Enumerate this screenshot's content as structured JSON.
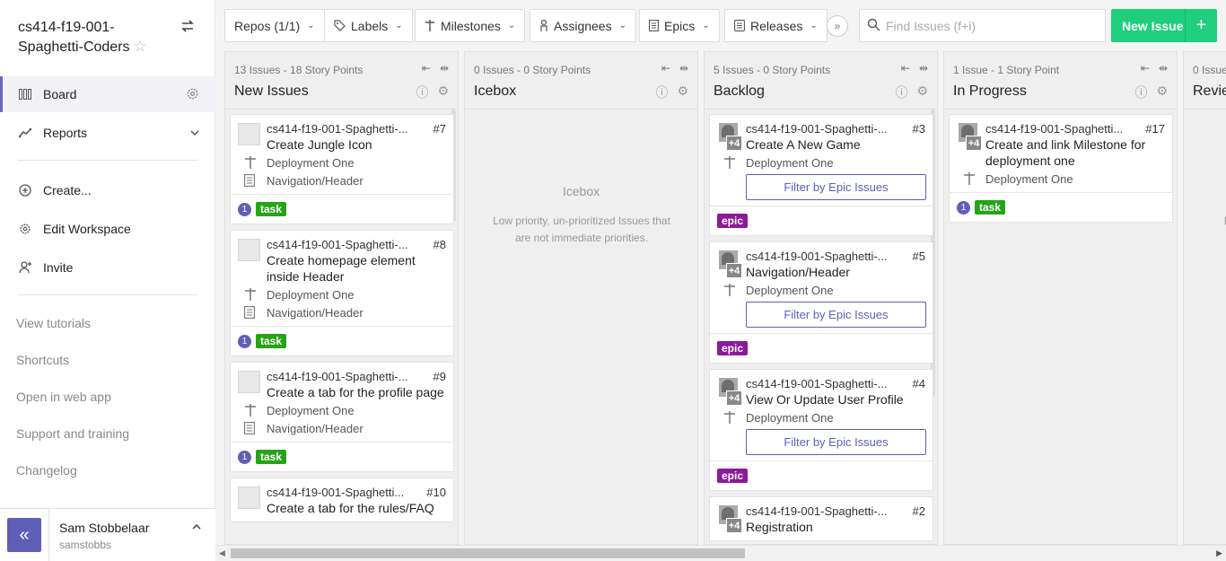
{
  "workspace": {
    "title": "cs414-f19-001-Spaghetti-Coders"
  },
  "nav": {
    "board": "Board",
    "reports": "Reports",
    "create": "Create...",
    "edit_workspace": "Edit Workspace",
    "invite": "Invite"
  },
  "links": {
    "tutorials": "View tutorials",
    "shortcuts": "Shortcuts",
    "web_app": "Open in web app",
    "support": "Support and training",
    "changelog": "Changelog"
  },
  "user": {
    "name": "Sam Stobbelaar",
    "handle": "samstobbs"
  },
  "toolbar": {
    "repos": "Repos (1/1)",
    "labels": "Labels",
    "milestones": "Milestones",
    "assignees": "Assignees",
    "epics": "Epics",
    "releases": "Releases",
    "search_placeholder": "Find Issues (f+i)",
    "new_issue": "New Issue"
  },
  "pipelines": [
    {
      "count": "13 Issues",
      "points": "18 Story Points",
      "name": "New Issues",
      "cards": [
        {
          "repo": "cs414-f19-001-Spaghetti-...",
          "num": "#7",
          "title": "Create Jungle Icon",
          "milestone": "Deployment One",
          "epic": "Navigation/Header",
          "estimate": "1",
          "label": "task"
        },
        {
          "repo": "cs414-f19-001-Spaghetti-...",
          "num": "#8",
          "title": "Create homepage element inside Header",
          "milestone": "Deployment One",
          "epic": "Navigation/Header",
          "estimate": "1",
          "label": "task"
        },
        {
          "repo": "cs414-f19-001-Spaghetti-...",
          "num": "#9",
          "title": "Create a tab for the profile page",
          "milestone": "Deployment One",
          "epic": "Navigation/Header",
          "estimate": "1",
          "label": "task"
        },
        {
          "repo": "cs414-f19-001-Spaghetti...",
          "num": "#10",
          "title": "Create a tab for the rules/FAQ"
        }
      ]
    },
    {
      "count": "0 Issues",
      "points": "0 Story Points",
      "name": "Icebox",
      "empty_title": "Icebox",
      "empty_desc": "Low priority, un-prioritized Issues that are not immediate priorities."
    },
    {
      "count": "5 Issues",
      "points": "0 Story Points",
      "name": "Backlog",
      "cards": [
        {
          "repo": "cs414-f19-001-Spaghetti-...",
          "num": "#3",
          "title": "Create A New Game",
          "milestone": "Deployment One",
          "filter": "Filter by Epic Issues",
          "label": "epic",
          "more": "+4"
        },
        {
          "repo": "cs414-f19-001-Spaghetti-...",
          "num": "#5",
          "title": "Navigation/Header",
          "milestone": "Deployment One",
          "filter": "Filter by Epic Issues",
          "label": "epic",
          "more": "+4"
        },
        {
          "repo": "cs414-f19-001-Spaghetti-...",
          "num": "#4",
          "title": "View Or Update User Profile",
          "milestone": "Deployment One",
          "filter": "Filter by Epic Issues",
          "label": "epic",
          "more": "+4"
        },
        {
          "repo": "cs414-f19-001-Spaghetti-...",
          "num": "#2",
          "title": "Registration",
          "more": "+4"
        }
      ]
    },
    {
      "count": "1 Issue",
      "points": "1 Story Point",
      "name": "In Progress",
      "cards": [
        {
          "repo": "cs414-f19-001-Spaghetti...",
          "num": "#17",
          "title": "Create and link Milestone for deployment one",
          "milestone": "Deployment One",
          "estimate": "1",
          "label": "task",
          "more": "+4"
        }
      ]
    },
    {
      "count": "0 Issue",
      "name": "Revie",
      "empty_title": "",
      "empty_desc": "Iss a"
    }
  ]
}
